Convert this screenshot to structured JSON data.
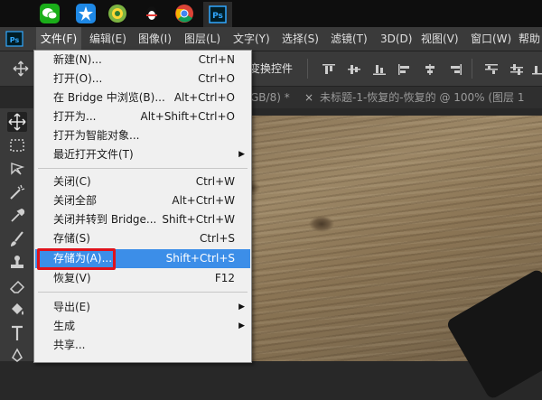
{
  "taskbar": {
    "apps": [
      {
        "icon": "wechat-icon"
      },
      {
        "icon": "star-app-icon"
      },
      {
        "icon": "360-browser-icon"
      },
      {
        "icon": "qq-icon"
      },
      {
        "icon": "chrome-icon"
      },
      {
        "icon": "photoshop-icon",
        "label": "Ps"
      }
    ]
  },
  "menubar": {
    "logo": "Ps",
    "items": [
      "文件(F)",
      "编辑(E)",
      "图像(I)",
      "图层(L)",
      "文字(Y)",
      "选择(S)",
      "滤镜(T)",
      "3D(D)",
      "视图(V)",
      "窗口(W)",
      "帮助"
    ]
  },
  "options_bar": {
    "transform_label": "变换控件"
  },
  "tabs": {
    "partial_tab": "GB/8) *",
    "close_mark": "×",
    "active_title": "未标题-1-恢复的-恢复的 @ 100% (图层 1"
  },
  "file_menu": {
    "items": [
      {
        "label": "新建(N)...",
        "shortcut": "Ctrl+N"
      },
      {
        "label": "打开(O)...",
        "shortcut": "Ctrl+O"
      },
      {
        "label": "在 Bridge 中浏览(B)...",
        "shortcut": "Alt+Ctrl+O"
      },
      {
        "label": "打开为...",
        "shortcut": "Alt+Shift+Ctrl+O"
      },
      {
        "label": "打开为智能对象...",
        "shortcut": ""
      },
      {
        "label": "最近打开文件(T)",
        "shortcut": "",
        "submenu": true
      },
      {
        "label": "关闭(C)",
        "shortcut": "Ctrl+W"
      },
      {
        "label": "关闭全部",
        "shortcut": "Alt+Ctrl+W"
      },
      {
        "label": "关闭并转到 Bridge...",
        "shortcut": "Shift+Ctrl+W"
      },
      {
        "label": "存储(S)",
        "shortcut": "Ctrl+S"
      },
      {
        "label": "存储为(A)...",
        "shortcut": "Shift+Ctrl+S",
        "highlighted": true
      },
      {
        "label": "恢复(V)",
        "shortcut": "F12"
      },
      {
        "label": "导出(E)",
        "shortcut": "",
        "submenu": true
      },
      {
        "label": "生成",
        "shortcut": "",
        "submenu": true
      },
      {
        "label": "共享...",
        "shortcut": ""
      }
    ]
  },
  "colors": {
    "highlight": "#3c8ee8",
    "annotation_box": "#e0121b",
    "ps_blue": "#31a8ff"
  }
}
